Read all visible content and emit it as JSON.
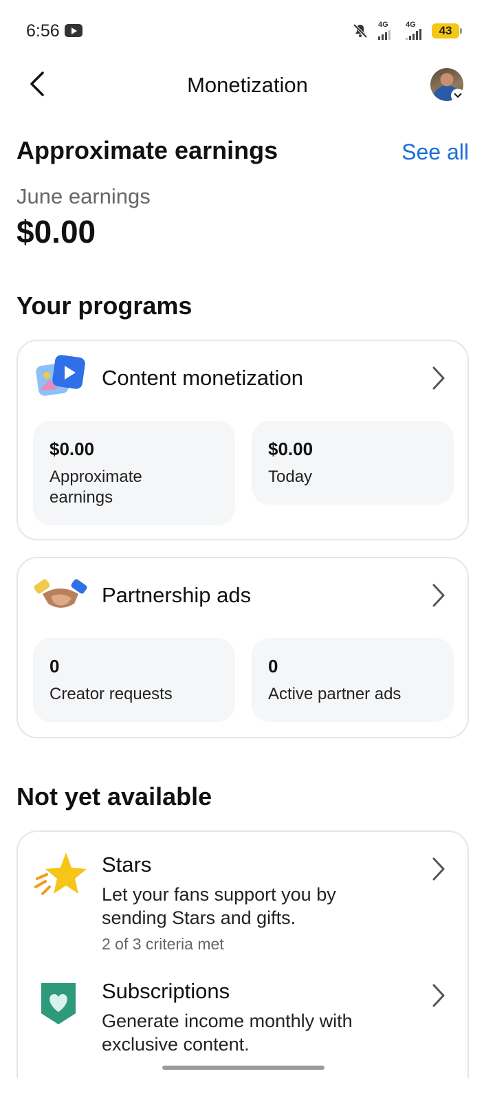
{
  "status_bar": {
    "time": "6:56",
    "network_1": "4G",
    "network_2": "4G",
    "battery": "43"
  },
  "header": {
    "title": "Monetization",
    "back_icon": "chevron-left-icon",
    "avatar_icon": "profile-avatar"
  },
  "earnings": {
    "heading": "Approximate earnings",
    "see_all": "See all",
    "period_label": "June earnings",
    "amount": "$0.00"
  },
  "programs": {
    "heading": "Your programs",
    "items": [
      {
        "title": "Content monetization",
        "stats": [
          {
            "value": "$0.00",
            "label": "Approximate earnings"
          },
          {
            "value": "$0.00",
            "label": "Today"
          }
        ]
      },
      {
        "title": "Partnership ads",
        "stats": [
          {
            "value": "0",
            "label": "Creator requests"
          },
          {
            "value": "0",
            "label": "Active partner ads"
          }
        ]
      }
    ]
  },
  "not_available": {
    "heading": "Not yet available",
    "items": [
      {
        "title": "Stars",
        "description": "Let your fans support you by sending Stars and gifts.",
        "meta": "2 of 3 criteria met"
      },
      {
        "title": "Subscriptions",
        "description": "Generate income monthly with exclusive content."
      }
    ]
  },
  "colors": {
    "link": "#1a6fd8",
    "battery": "#f4c812",
    "card_border": "#e4e6ea",
    "stat_bg": "#f5f6f8"
  }
}
